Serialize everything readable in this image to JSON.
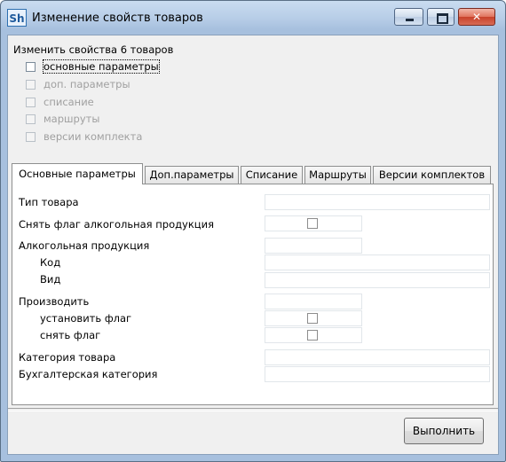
{
  "window": {
    "title": "Изменение свойств товаров",
    "app_icon_text": "Sh",
    "close_glyph": "✕"
  },
  "heading": "Изменить свойства 6 товаров",
  "checkboxes": [
    {
      "label": "основные  параметры",
      "enabled": true,
      "checked": false
    },
    {
      "label": "доп. параметры",
      "enabled": false,
      "checked": false
    },
    {
      "label": "списание",
      "enabled": false,
      "checked": false
    },
    {
      "label": "маршруты",
      "enabled": false,
      "checked": false
    },
    {
      "label": "версии комплекта",
      "enabled": false,
      "checked": false
    }
  ],
  "tabs": [
    {
      "label": "Основные параметры",
      "active": true
    },
    {
      "label": "Доп.параметры",
      "active": false
    },
    {
      "label": "Списание",
      "active": false
    },
    {
      "label": "Маршруты",
      "active": false
    },
    {
      "label": "Версии комплектов",
      "active": false
    }
  ],
  "fields": {
    "product_type": {
      "label": "Тип товара",
      "value": ""
    },
    "remove_alcohol_flag": {
      "label": "Снять флаг алкогольная продукция",
      "checked": false
    },
    "alcohol_products": {
      "label": "Алкогольная продукция",
      "value": ""
    },
    "code": {
      "label": "Код",
      "value": ""
    },
    "kind": {
      "label": "Вид",
      "value": ""
    },
    "produce": {
      "label": "Производить",
      "value": ""
    },
    "set_flag": {
      "label": "установить флаг",
      "checked": false
    },
    "unset_flag": {
      "label": "снять флаг",
      "checked": false
    },
    "product_category": {
      "label": "Категория товара",
      "value": ""
    },
    "accounting_category": {
      "label": "Бухгалтерская категория",
      "value": ""
    }
  },
  "buttons": {
    "run": "Выполнить"
  }
}
